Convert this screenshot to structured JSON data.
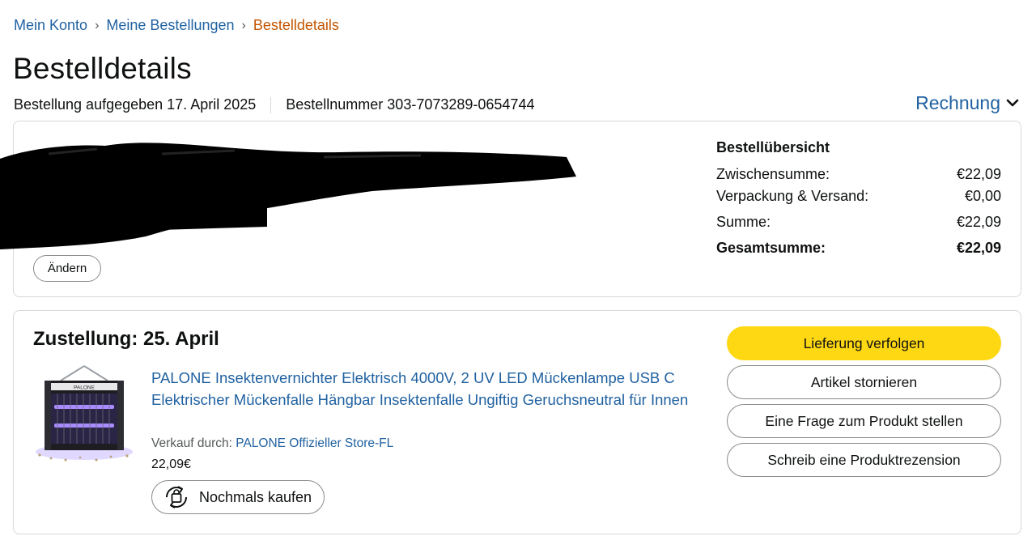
{
  "breadcrumb": {
    "account": "Mein Konto",
    "orders": "Meine Bestellungen",
    "current": "Bestelldetails",
    "separator": "›"
  },
  "page_title": "Bestelldetails",
  "order": {
    "placed": "Bestellung aufgegeben 17. April 2025",
    "number": "Bestellnummer 303-7073289-0654744"
  },
  "invoice_label": "Rechnung",
  "address_section": {
    "change_label": "Ändern"
  },
  "summary": {
    "heading": "Bestellübersicht",
    "subtotal_label": "Zwischensumme:",
    "subtotal_value": "€22,09",
    "shipping_label": "Verpackung & Versand:",
    "shipping_value": "€0,00",
    "sum_label": "Summe:",
    "sum_value": "€22,09",
    "total_label": "Gesamtsumme:",
    "total_value": "€22,09"
  },
  "delivery": {
    "title": "Zustellung: 25. April",
    "product_title": "PALONE Insektenvernichter Elektrisch 4000V, 2 UV LED Mückenlampe USB C Elektrischer Mückenfalle Hängbar Insektenfalle Ungiftig Geruchsneutral für Innen",
    "sold_by_label": "Verkauf durch:",
    "seller": "PALONE Offizieller Store-FL",
    "price": "22,09€",
    "buy_again_label": "Nochmals kaufen",
    "image_brand": "PALONE"
  },
  "actions": {
    "track": "Lieferung verfolgen",
    "cancel": "Artikel stornieren",
    "question": "Eine Frage zum Produkt stellen",
    "review": "Schreib eine Produktrezension"
  },
  "colors": {
    "link": "#2162a1",
    "breadcrumb_current": "#c45500",
    "primary_button": "#ffd814",
    "border": "#d5d9d9"
  }
}
